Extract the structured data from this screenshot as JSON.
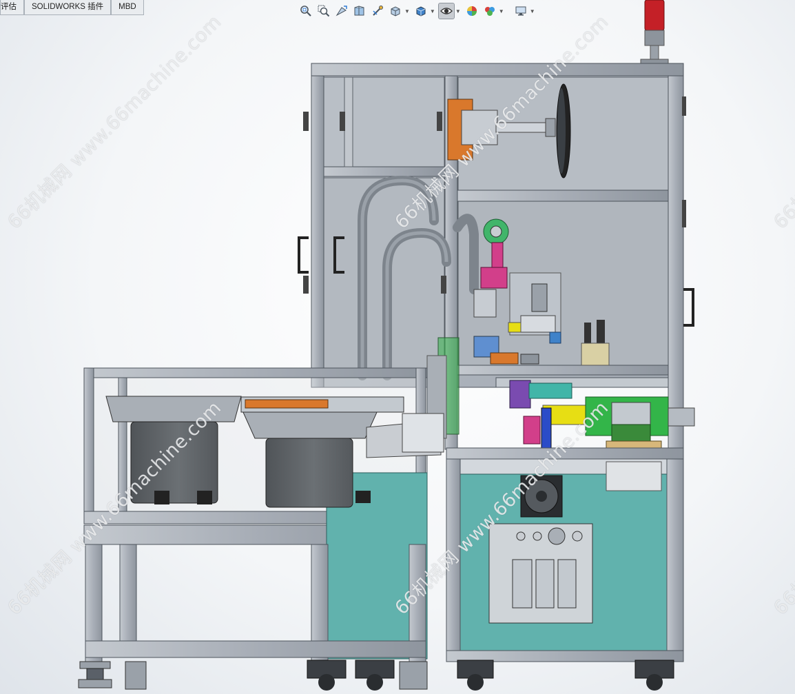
{
  "tabs": [
    {
      "label": "评估"
    },
    {
      "label": "SOLIDWORKS 插件"
    },
    {
      "label": "MBD"
    }
  ],
  "toolbar": {
    "icons": [
      "zoom-to-fit-icon",
      "zoom-to-area-icon",
      "previous-view-icon",
      "section-view-icon",
      "dynamic-annotation-icon",
      "view-orientation-icon",
      "display-style-icon",
      "hide-show-items-icon",
      "edit-appearance-icon",
      "apply-scene-icon",
      "view-settings-icon"
    ],
    "active": "hide-show-items-icon"
  },
  "watermark": {
    "text": "66机械网 www.66machine.com",
    "repeats": 6
  },
  "colors": {
    "frame": "#a7adb6",
    "panel_glass": "#aeb5bd",
    "cabinet_teal": "#61b2ad",
    "orange_part": "#d9782c",
    "pink_part": "#d23f8a",
    "yellow_part": "#e7de14",
    "green_part": "#33b549",
    "tower_light": "#c42027"
  }
}
